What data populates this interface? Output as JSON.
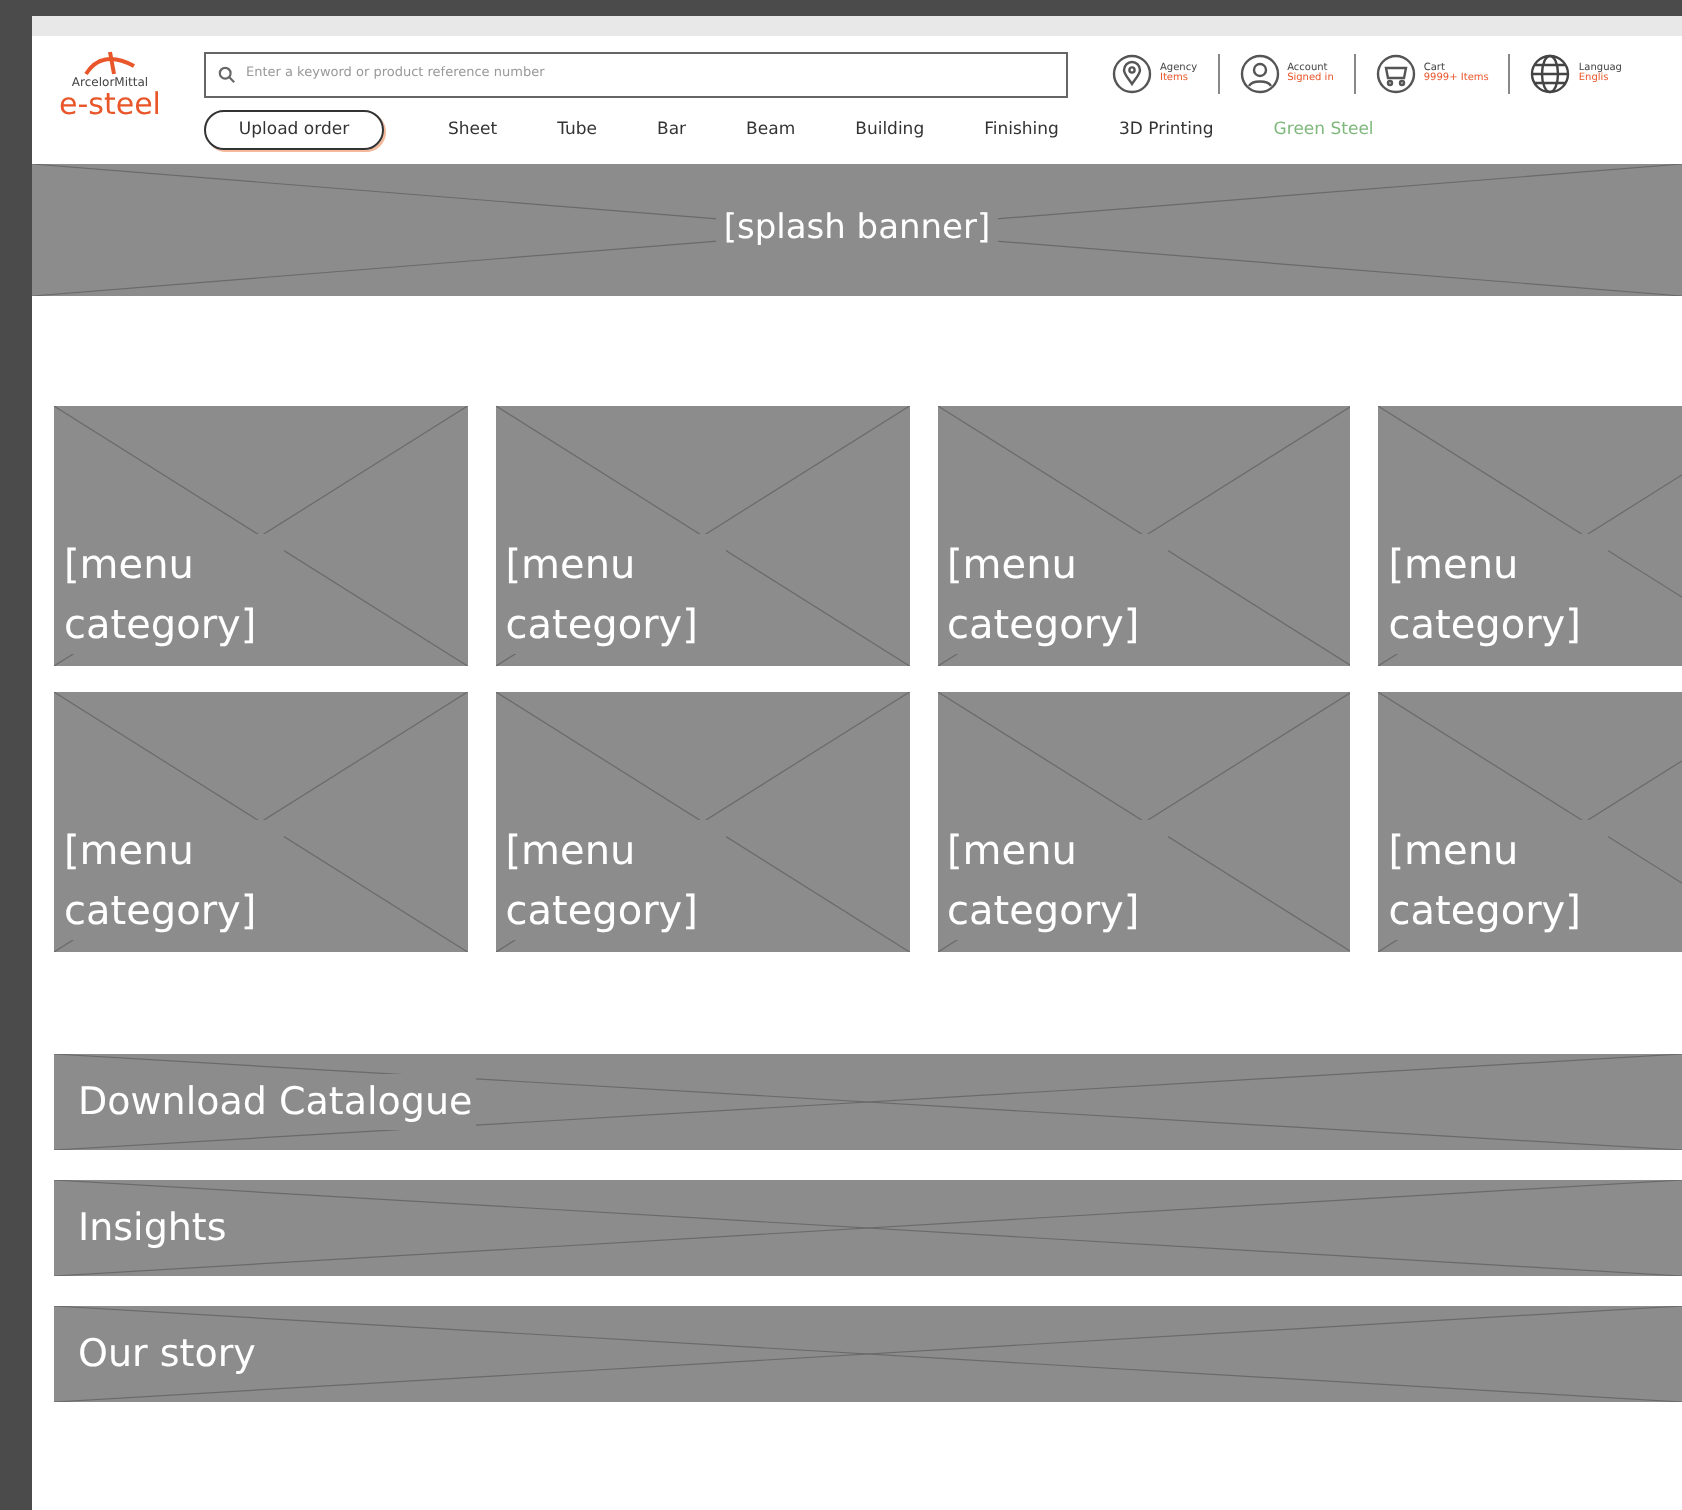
{
  "header": {
    "logo": {
      "brand": "ArcelorMittal",
      "product": "e-steel"
    },
    "search": {
      "placeholder": "Enter a keyword or product reference number"
    },
    "utilities": [
      {
        "kind": "agency",
        "label": "Agency",
        "value": "Items"
      },
      {
        "kind": "account",
        "label": "Account",
        "value": "Signed in"
      },
      {
        "kind": "cart",
        "label": "Cart",
        "value": "9999+ Items"
      },
      {
        "kind": "language",
        "label": "Languag",
        "value": "Englis"
      }
    ],
    "upload_button": "Upload order",
    "nav": [
      {
        "label": "Sheet",
        "accent": false
      },
      {
        "label": "Tube",
        "accent": false
      },
      {
        "label": "Bar",
        "accent": false
      },
      {
        "label": "Beam",
        "accent": false
      },
      {
        "label": "Building",
        "accent": false
      },
      {
        "label": "Finishing",
        "accent": false
      },
      {
        "label": "3D Printing",
        "accent": false
      },
      {
        "label": "Green Steel",
        "accent": true
      }
    ]
  },
  "banner": "[splash banner]",
  "categories": [
    {
      "label": "[menu category]"
    },
    {
      "label": "[menu category]"
    },
    {
      "label": "[menu category]"
    },
    {
      "label": "[menu category]"
    },
    {
      "label": "[menu category]"
    },
    {
      "label": "[menu category]"
    },
    {
      "label": "[menu category]"
    },
    {
      "label": "[menu category]"
    }
  ],
  "sections": [
    {
      "label": "Download Catalogue"
    },
    {
      "label": "Insights"
    },
    {
      "label": "Our story"
    }
  ]
}
